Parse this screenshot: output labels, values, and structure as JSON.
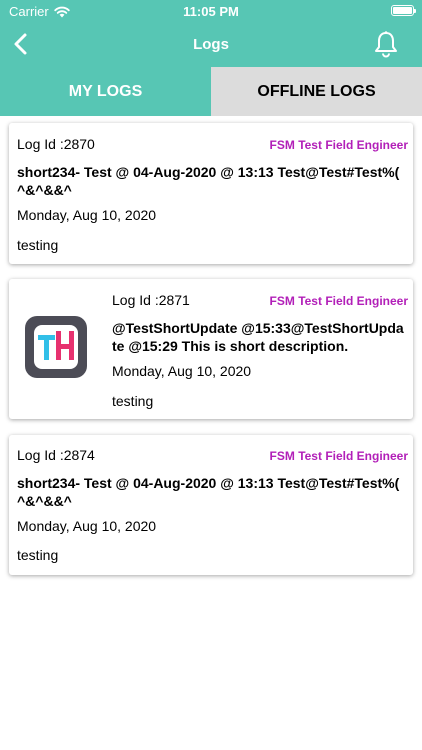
{
  "status_bar": {
    "carrier": "Carrier",
    "time": "11:05 PM"
  },
  "nav": {
    "title": "Logs",
    "back_icon": "chevron-left-icon",
    "bell_icon": "bell-icon"
  },
  "tabs": [
    {
      "label": "MY LOGS",
      "active": true
    },
    {
      "label": "OFFLINE LOGS",
      "active": false
    }
  ],
  "colors": {
    "accent": "#57c6b4",
    "engineer": "#b21fb8",
    "tab_inactive": "#dcdcdc"
  },
  "logs": [
    {
      "log_id": "Log Id :2870",
      "engineer": "FSM Test Field Engineer",
      "description": "short234- Test @ 04-Aug-2020 @ 13:13 Test@Test#Test%( ^&^&&^",
      "date": "Monday, Aug 10, 2020",
      "note": "testing"
    },
    {
      "log_id": "Log Id :2871",
      "engineer": "FSM Test Field Engineer",
      "description": "@TestShortUpdate @15:33@TestShortUpdate @15:29 This is short description.",
      "date": "Monday, Aug 10, 2020",
      "note": "testing",
      "thumbnail_icon": "th-app-logo-icon"
    },
    {
      "log_id": "Log Id :2874",
      "engineer": "FSM Test Field Engineer",
      "description": "short234- Test @ 04-Aug-2020 @ 13:13 Test@Test#Test%( ^&^&&^",
      "date": "Monday, Aug 10, 2020",
      "note": "testing"
    }
  ]
}
